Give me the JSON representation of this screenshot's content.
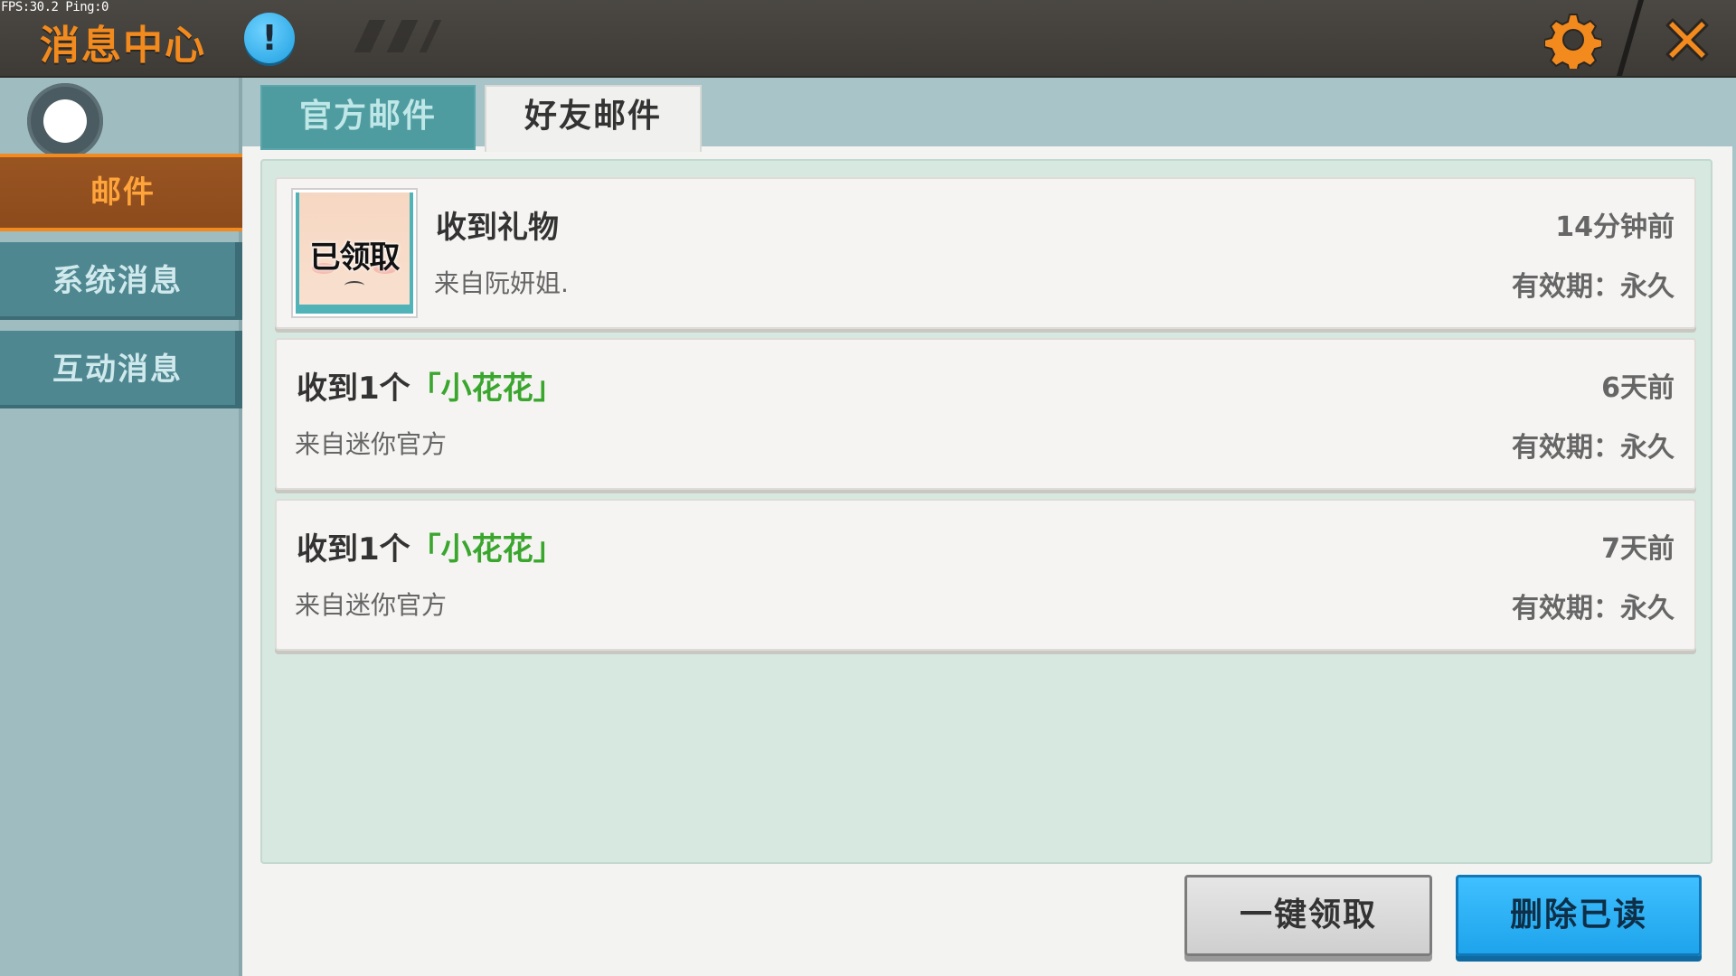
{
  "debug": {
    "fps_text": "FPS:30.2  Ping:0"
  },
  "header": {
    "title": "消息中心",
    "info_icon": "exclamation-icon",
    "settings_icon": "gear-icon",
    "close_icon": "close-icon",
    "info_glyph": "!"
  },
  "sidebar": {
    "avatar_icon": "profile-dot-icon",
    "items": [
      {
        "label": "邮件",
        "active": true
      },
      {
        "label": "系统消息",
        "active": false
      },
      {
        "label": "互动消息",
        "active": false
      }
    ]
  },
  "tabs": [
    {
      "label": "官方邮件",
      "active": false
    },
    {
      "label": "好友邮件",
      "active": true
    }
  ],
  "mails": [
    {
      "title": "收到礼物",
      "from": "来自阮妍姐.",
      "time": "14分钟前",
      "validity": "有效期：永久",
      "status_stamp": "已领取"
    },
    {
      "title_prefix": "收到1个",
      "item_name": "「小花花」",
      "from": "来自迷你官方",
      "time": "6天前",
      "validity": "有效期：永久"
    },
    {
      "title_prefix": "收到1个",
      "item_name": "「小花花」",
      "from": "来自迷你官方",
      "time": "7天前",
      "validity": "有效期：永久"
    }
  ],
  "actions": {
    "claim_all": "一键领取",
    "delete_read": "删除已读"
  },
  "colors": {
    "title_orange": "#f28a1e",
    "highlight_green": "#3aa62e",
    "teal_tab": "#4f9ca0",
    "blue_button": "#1ea4ec"
  }
}
